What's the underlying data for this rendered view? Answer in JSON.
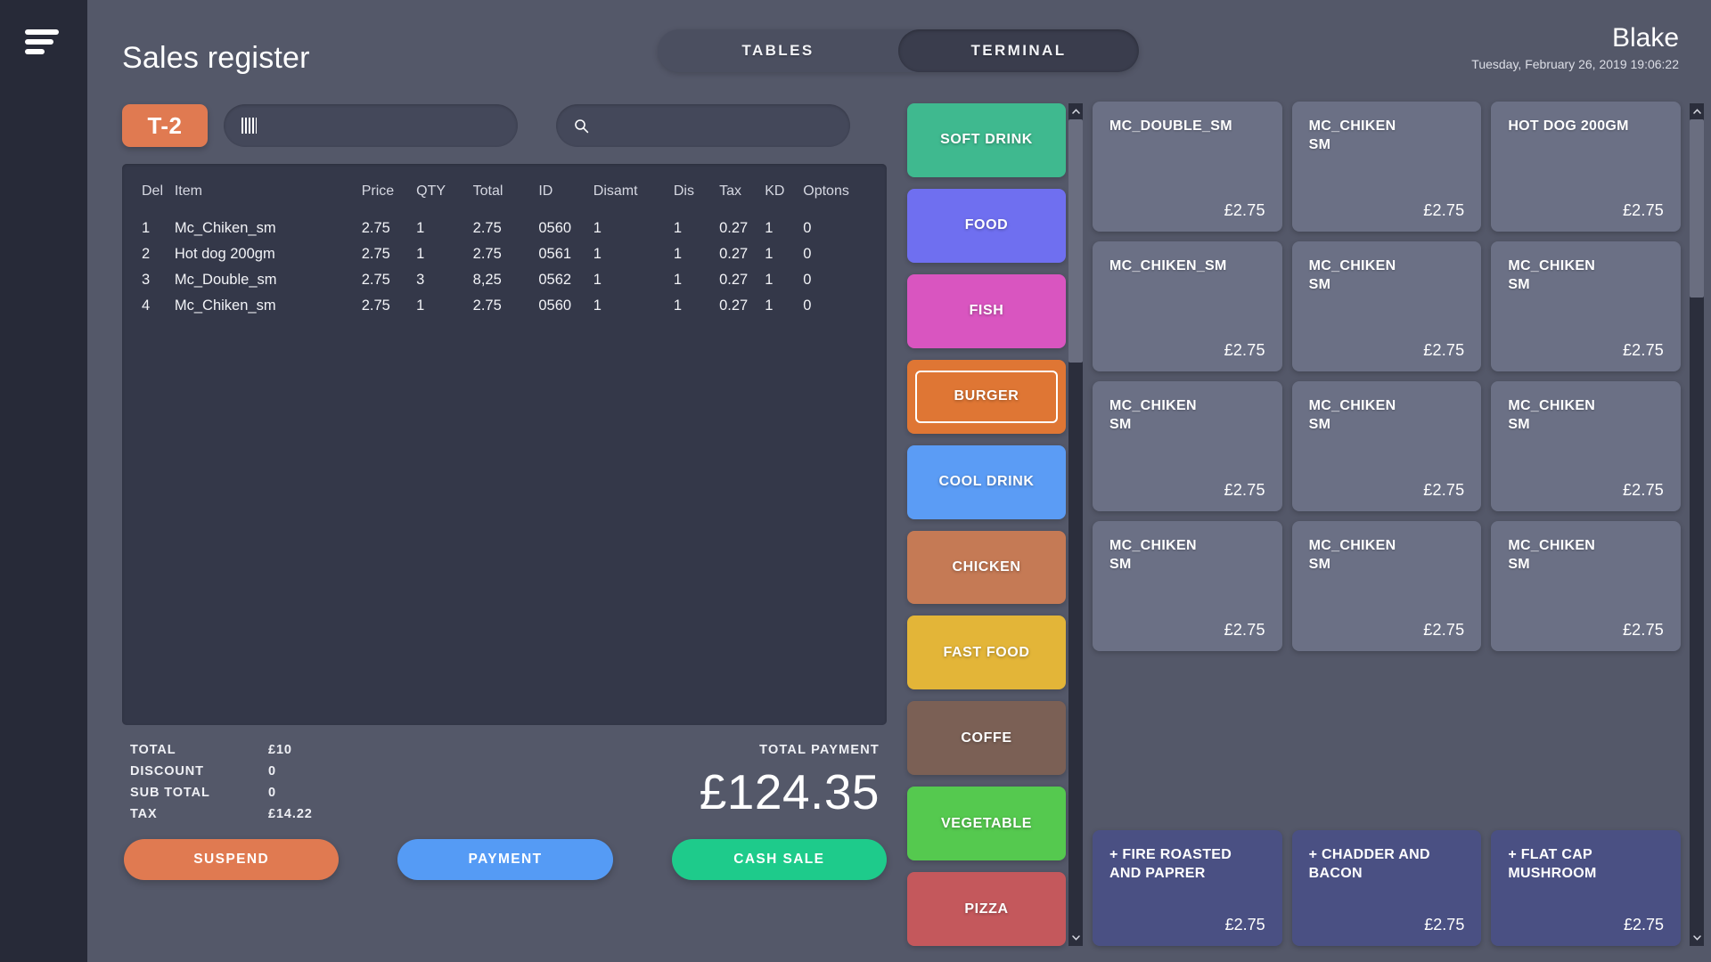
{
  "colors": {
    "app_bg": "#252836",
    "rail_bg": "#272a38",
    "stage_bg": "#545869",
    "panel_bg": "#343849",
    "accent_orange": "#e07a51",
    "accent_blue": "#559bf5",
    "accent_green": "#1ecb8b",
    "product_card": "#6b7085",
    "modifier_card": "#4a5083"
  },
  "rail": {
    "menu_icon": "hamburger-icon"
  },
  "header": {
    "title": "Sales register",
    "tabs": [
      {
        "label": "TABLES",
        "active": false
      },
      {
        "label": "TERMINAL",
        "active": true
      }
    ],
    "user_name": "Blake",
    "datetime": "Tuesday, February 26, 2019 19:06:22"
  },
  "order_toolbar": {
    "table_badge": "T-2",
    "barcode": {
      "icon": "barcode-icon",
      "value": "",
      "placeholder": ""
    },
    "search": {
      "icon": "search-icon",
      "value": "",
      "placeholder": ""
    }
  },
  "order_table": {
    "columns": [
      "Del",
      "Item",
      "Price",
      "QTY",
      "Total",
      "ID",
      "Disamt",
      "Dis",
      "Tax",
      "KD",
      "Optons"
    ],
    "rows": [
      {
        "del": "1",
        "item": "Mc_Chiken_sm",
        "price": "2.75",
        "qty": "1",
        "total": "2.75",
        "id": "0560",
        "disamt": "1",
        "dis": "1",
        "tax": "0.27",
        "kd": "1",
        "optons": "0"
      },
      {
        "del": "2",
        "item": "Hot dog 200gm",
        "price": "2.75",
        "qty": "1",
        "total": "2.75",
        "id": "0561",
        "disamt": "1",
        "dis": "1",
        "tax": "0.27",
        "kd": "1",
        "optons": "0"
      },
      {
        "del": "3",
        "item": "Mc_Double_sm",
        "price": "2.75",
        "qty": "3",
        "total": "8,25",
        "id": "0562",
        "disamt": "1",
        "dis": "1",
        "tax": "0.27",
        "kd": "1",
        "optons": "0"
      },
      {
        "del": "4",
        "item": "Mc_Chiken_sm",
        "price": "2.75",
        "qty": "1",
        "total": "2.75",
        "id": "0560",
        "disamt": "1",
        "dis": "1",
        "tax": "0.27",
        "kd": "1",
        "optons": "0"
      }
    ]
  },
  "totals": {
    "lines": [
      {
        "label": "TOTAL",
        "value": "£10"
      },
      {
        "label": "DISCOUNT",
        "value": "0"
      },
      {
        "label": "SUB TOTAL",
        "value": "0"
      },
      {
        "label": "TAX",
        "value": "£14.22"
      }
    ],
    "payment_label": "TOTAL PAYMENT",
    "payment_value": "£124.35"
  },
  "actions": [
    {
      "label": "SUSPEND",
      "color": "#e07a51"
    },
    {
      "label": "PAYMENT",
      "color": "#559bf5"
    },
    {
      "label": "CASH SALE",
      "color": "#1ecb8b"
    }
  ],
  "categories": [
    {
      "label": "SOFT DRINK",
      "color": "#3fb98f",
      "selected": false
    },
    {
      "label": "FOOD",
      "color": "#6f6ff0",
      "selected": false
    },
    {
      "label": "FISH",
      "color": "#d955c0",
      "selected": false
    },
    {
      "label": "BURGER",
      "color": "#df7634",
      "selected": true
    },
    {
      "label": "COOL DRINK",
      "color": "#5b9cf5",
      "selected": false
    },
    {
      "label": "CHICKEN",
      "color": "#c57a55",
      "selected": false
    },
    {
      "label": "FAST FOOD",
      "color": "#e3b538",
      "selected": false
    },
    {
      "label": "COFFE",
      "color": "#7b6055",
      "selected": false
    },
    {
      "label": "VEGETABLE",
      "color": "#55c94f",
      "selected": false
    },
    {
      "label": "PIZZA",
      "color": "#c4585c",
      "selected": false
    }
  ],
  "products": [
    {
      "name": "MC_DOUBLE_SM",
      "price": "£2.75"
    },
    {
      "name": "MC_CHIKEN\nSM",
      "price": "£2.75"
    },
    {
      "name": "HOT DOG 200GM",
      "price": "£2.75"
    },
    {
      "name": "MC_CHIKEN_SM",
      "price": "£2.75"
    },
    {
      "name": "MC_CHIKEN\nSM",
      "price": "£2.75"
    },
    {
      "name": "MC_CHIKEN\nSM",
      "price": "£2.75"
    },
    {
      "name": "MC_CHIKEN\nSM",
      "price": "£2.75"
    },
    {
      "name": "MC_CHIKEN\nSM",
      "price": "£2.75"
    },
    {
      "name": "MC_CHIKEN\nSM",
      "price": "£2.75"
    },
    {
      "name": "MC_CHIKEN\nSM",
      "price": "£2.75"
    },
    {
      "name": "MC_CHIKEN\nSM",
      "price": "£2.75"
    },
    {
      "name": "MC_CHIKEN\nSM",
      "price": "£2.75"
    }
  ],
  "modifiers": [
    {
      "name": "+ FIRE ROASTED\nAND PAPRER",
      "price": "£2.75"
    },
    {
      "name": "+ CHADDER AND\nBACON",
      "price": "£2.75"
    },
    {
      "name": "+ FLAT CAP\nMUSHROOM",
      "price": "£2.75"
    }
  ],
  "scrollbars": {
    "category": {
      "up": "chevron-up-icon",
      "down": "chevron-down-icon"
    },
    "product": {
      "up": "chevron-up-icon",
      "down": "chevron-down-icon"
    }
  }
}
